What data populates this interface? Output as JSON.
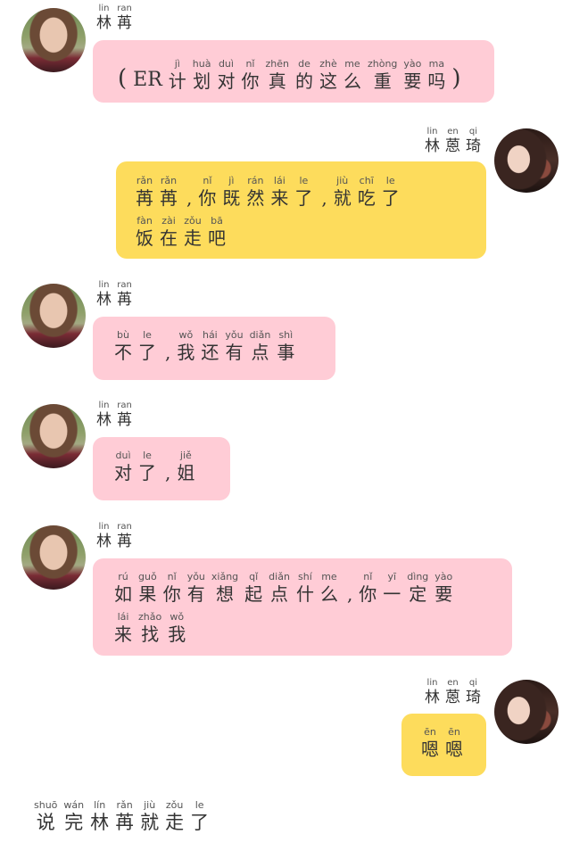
{
  "messages": [
    {
      "side": "left",
      "color": "pink",
      "sender": [
        {
          "py": "lin",
          "hz": "林"
        },
        {
          "py": "ran",
          "hz": "苒"
        }
      ],
      "lines": [
        [
          {
            "hz": "(",
            "py": "",
            "cls": "paren"
          },
          {
            "hz": "ER",
            "py": "",
            "cls": "er"
          },
          {
            "hz": "计",
            "py": "jì"
          },
          {
            "hz": "划",
            "py": "huà"
          },
          {
            "hz": "对",
            "py": "duì"
          },
          {
            "hz": "你",
            "py": "nǐ"
          },
          {
            "hz": "真",
            "py": "zhēn"
          },
          {
            "hz": "的",
            "py": "de"
          },
          {
            "hz": "这",
            "py": "zhè"
          },
          {
            "hz": "么",
            "py": "me"
          },
          {
            "hz": "重",
            "py": "zhòng"
          },
          {
            "hz": "要",
            "py": "yào"
          },
          {
            "hz": "吗",
            "py": "ma"
          },
          {
            "hz": ")",
            "py": "",
            "cls": "paren"
          }
        ]
      ]
    },
    {
      "side": "right",
      "color": "yellow",
      "sender": [
        {
          "py": "lin",
          "hz": "林"
        },
        {
          "py": "en",
          "hz": "蒽"
        },
        {
          "py": "qi",
          "hz": "琦"
        }
      ],
      "lines": [
        [
          {
            "hz": "苒",
            "py": "rǎn"
          },
          {
            "hz": "苒",
            "py": "rǎn"
          },
          {
            "hz": ",",
            "py": "",
            "cls": "punct"
          },
          {
            "hz": "你",
            "py": "nǐ"
          },
          {
            "hz": "既",
            "py": "jì"
          },
          {
            "hz": "然",
            "py": "rán"
          },
          {
            "hz": "来",
            "py": "lái"
          },
          {
            "hz": "了",
            "py": "le"
          },
          {
            "hz": ",",
            "py": "",
            "cls": "punct"
          },
          {
            "hz": "就",
            "py": "jiù"
          },
          {
            "hz": "吃",
            "py": "chī"
          },
          {
            "hz": "了",
            "py": "le"
          }
        ],
        [
          {
            "hz": "饭",
            "py": "fàn"
          },
          {
            "hz": "在",
            "py": "zài"
          },
          {
            "hz": "走",
            "py": "zǒu"
          },
          {
            "hz": "吧",
            "py": "bā"
          }
        ]
      ]
    },
    {
      "side": "left",
      "color": "pink",
      "sender": [
        {
          "py": "lin",
          "hz": "林"
        },
        {
          "py": "ran",
          "hz": "苒"
        }
      ],
      "lines": [
        [
          {
            "hz": "不",
            "py": "bù"
          },
          {
            "hz": "了",
            "py": "le"
          },
          {
            "hz": ",",
            "py": "",
            "cls": "punct"
          },
          {
            "hz": "我",
            "py": "wǒ"
          },
          {
            "hz": "还",
            "py": "hái"
          },
          {
            "hz": "有",
            "py": "yǒu"
          },
          {
            "hz": "点",
            "py": "diǎn"
          },
          {
            "hz": "事",
            "py": "shì"
          }
        ]
      ]
    },
    {
      "side": "left",
      "color": "pink",
      "sender": [
        {
          "py": "lin",
          "hz": "林"
        },
        {
          "py": "ran",
          "hz": "苒"
        }
      ],
      "lines": [
        [
          {
            "hz": "对",
            "py": "duì"
          },
          {
            "hz": "了",
            "py": "le"
          },
          {
            "hz": ",",
            "py": "",
            "cls": "punct"
          },
          {
            "hz": "姐",
            "py": "jiě"
          }
        ]
      ]
    },
    {
      "side": "left",
      "color": "pink",
      "sender": [
        {
          "py": "lin",
          "hz": "林"
        },
        {
          "py": "ran",
          "hz": "苒"
        }
      ],
      "lines": [
        [
          {
            "hz": "如",
            "py": "rú"
          },
          {
            "hz": "果",
            "py": "guǒ"
          },
          {
            "hz": "你",
            "py": "nǐ"
          },
          {
            "hz": "有",
            "py": "yǒu"
          },
          {
            "hz": "想",
            "py": "xiǎng"
          },
          {
            "hz": "起",
            "py": "qǐ"
          },
          {
            "hz": "点",
            "py": "diǎn"
          },
          {
            "hz": "什",
            "py": "shí"
          },
          {
            "hz": "么",
            "py": "me"
          },
          {
            "hz": ",",
            "py": "",
            "cls": "punct"
          },
          {
            "hz": "你",
            "py": "nǐ"
          },
          {
            "hz": "一",
            "py": "yī"
          },
          {
            "hz": "定",
            "py": "dìng"
          },
          {
            "hz": "要",
            "py": "yào"
          }
        ],
        [
          {
            "hz": "来",
            "py": "lái"
          },
          {
            "hz": "找",
            "py": "zhǎo"
          },
          {
            "hz": "我",
            "py": "wǒ"
          }
        ]
      ]
    },
    {
      "side": "right",
      "color": "yellow",
      "sender": [
        {
          "py": "lin",
          "hz": "林"
        },
        {
          "py": "en",
          "hz": "蒽"
        },
        {
          "py": "qi",
          "hz": "琦"
        }
      ],
      "lines": [
        [
          {
            "hz": "嗯",
            "py": "ēn"
          },
          {
            "hz": "嗯",
            "py": "ēn"
          }
        ]
      ]
    }
  ],
  "narration": [
    {
      "hz": "说",
      "py": "shuō"
    },
    {
      "hz": "完",
      "py": "wán"
    },
    {
      "hz": "林",
      "py": "lín"
    },
    {
      "hz": "苒",
      "py": "rǎn"
    },
    {
      "hz": "就",
      "py": "jiù"
    },
    {
      "hz": "走",
      "py": "zǒu"
    },
    {
      "hz": "了",
      "py": "le"
    }
  ]
}
